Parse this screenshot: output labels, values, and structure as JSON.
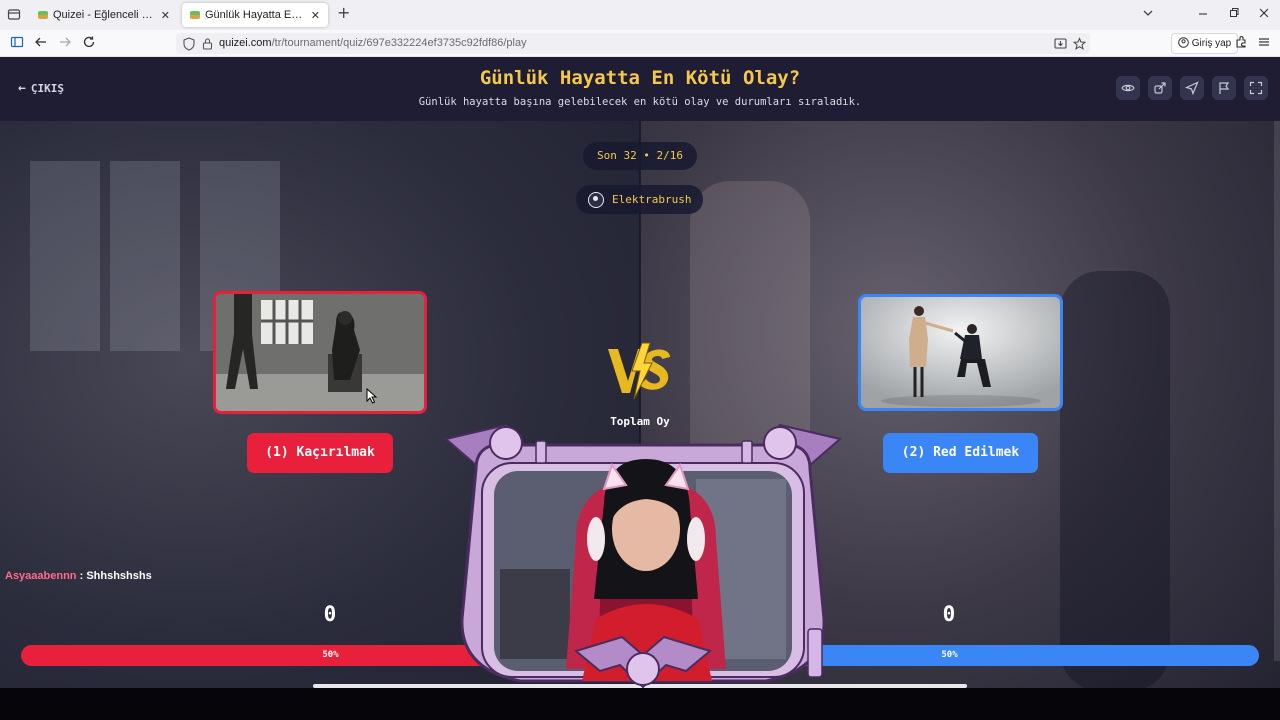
{
  "browser": {
    "tabs": [
      {
        "title": "Quizei - Eğlenceli ve etkileşimli",
        "active": false
      },
      {
        "title": "Günlük Hayatta En Kötü Olay? -",
        "active": true
      }
    ],
    "new_tab_glyph": "+",
    "url_host": "quizei.com",
    "url_path": "/tr/tournament/quiz/697e332224ef3735c92fdf86/play",
    "login_label": "Giriş yap",
    "icons": [
      "tab-list-icon",
      "sidebar-icon",
      "back-icon",
      "forward-icon",
      "reload-icon",
      "shield-icon",
      "lock-icon",
      "install-icon",
      "star-icon",
      "account-icon",
      "extensions-icon",
      "menu-icon",
      "chevron-down-icon",
      "minimize-icon",
      "restore-icon",
      "close-icon"
    ]
  },
  "header": {
    "exit_label": "ÇIKIŞ",
    "title": "Günlük Hayatta En Kötü Olay?",
    "subtitle": "Günlük hayatta başına gelebilecek en kötü olay ve durumları sıraladık.",
    "action_icons": [
      "eye-icon",
      "share-icon",
      "send-icon",
      "flag-icon",
      "fullscreen-icon"
    ]
  },
  "round": {
    "label": "Son 32 • 2/16",
    "author": "Elektrabrush",
    "total_votes_label": "Toplam Oy"
  },
  "options": {
    "left": {
      "label": "(1) Kaçırılmak",
      "votes": "0",
      "percent": "50%",
      "percent_value": 50
    },
    "right": {
      "label": "(2) Red Edilmek",
      "votes": "0",
      "percent": "50%",
      "percent_value": 50
    }
  },
  "chat": {
    "user": "Asyaaabennn",
    "separator": " : ",
    "message": "Shhshshshs"
  },
  "colors": {
    "accent": "#f5c84a",
    "left": "#e8203c",
    "right": "#3b86f6",
    "header_bg": "#1e1d33"
  }
}
